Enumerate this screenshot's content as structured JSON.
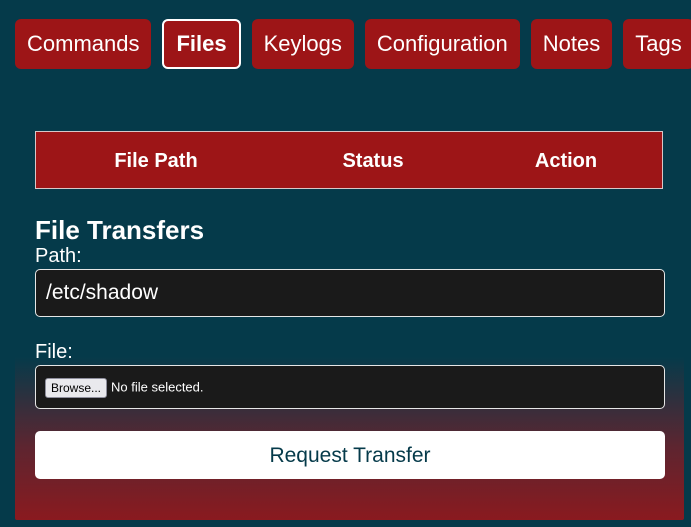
{
  "nav": {
    "tabs": [
      {
        "label": "Commands"
      },
      {
        "label": "Files",
        "active": true
      },
      {
        "label": "Keylogs"
      },
      {
        "label": "Configuration"
      },
      {
        "label": "Notes"
      },
      {
        "label": "Tags"
      }
    ]
  },
  "table": {
    "headers": [
      "File Path",
      "Status",
      "Action"
    ]
  },
  "form": {
    "title": "File Transfers",
    "path_label": "Path:",
    "path_value": "/etc/shadow",
    "file_label": "File:",
    "browse_label": "Browse...",
    "file_status": "No file selected.",
    "submit_label": "Request Transfer"
  },
  "colors": {
    "background": "#053a4a",
    "accent": "#9d1517",
    "input_bg": "#1a1a1a",
    "button_text": "#053a4a"
  }
}
